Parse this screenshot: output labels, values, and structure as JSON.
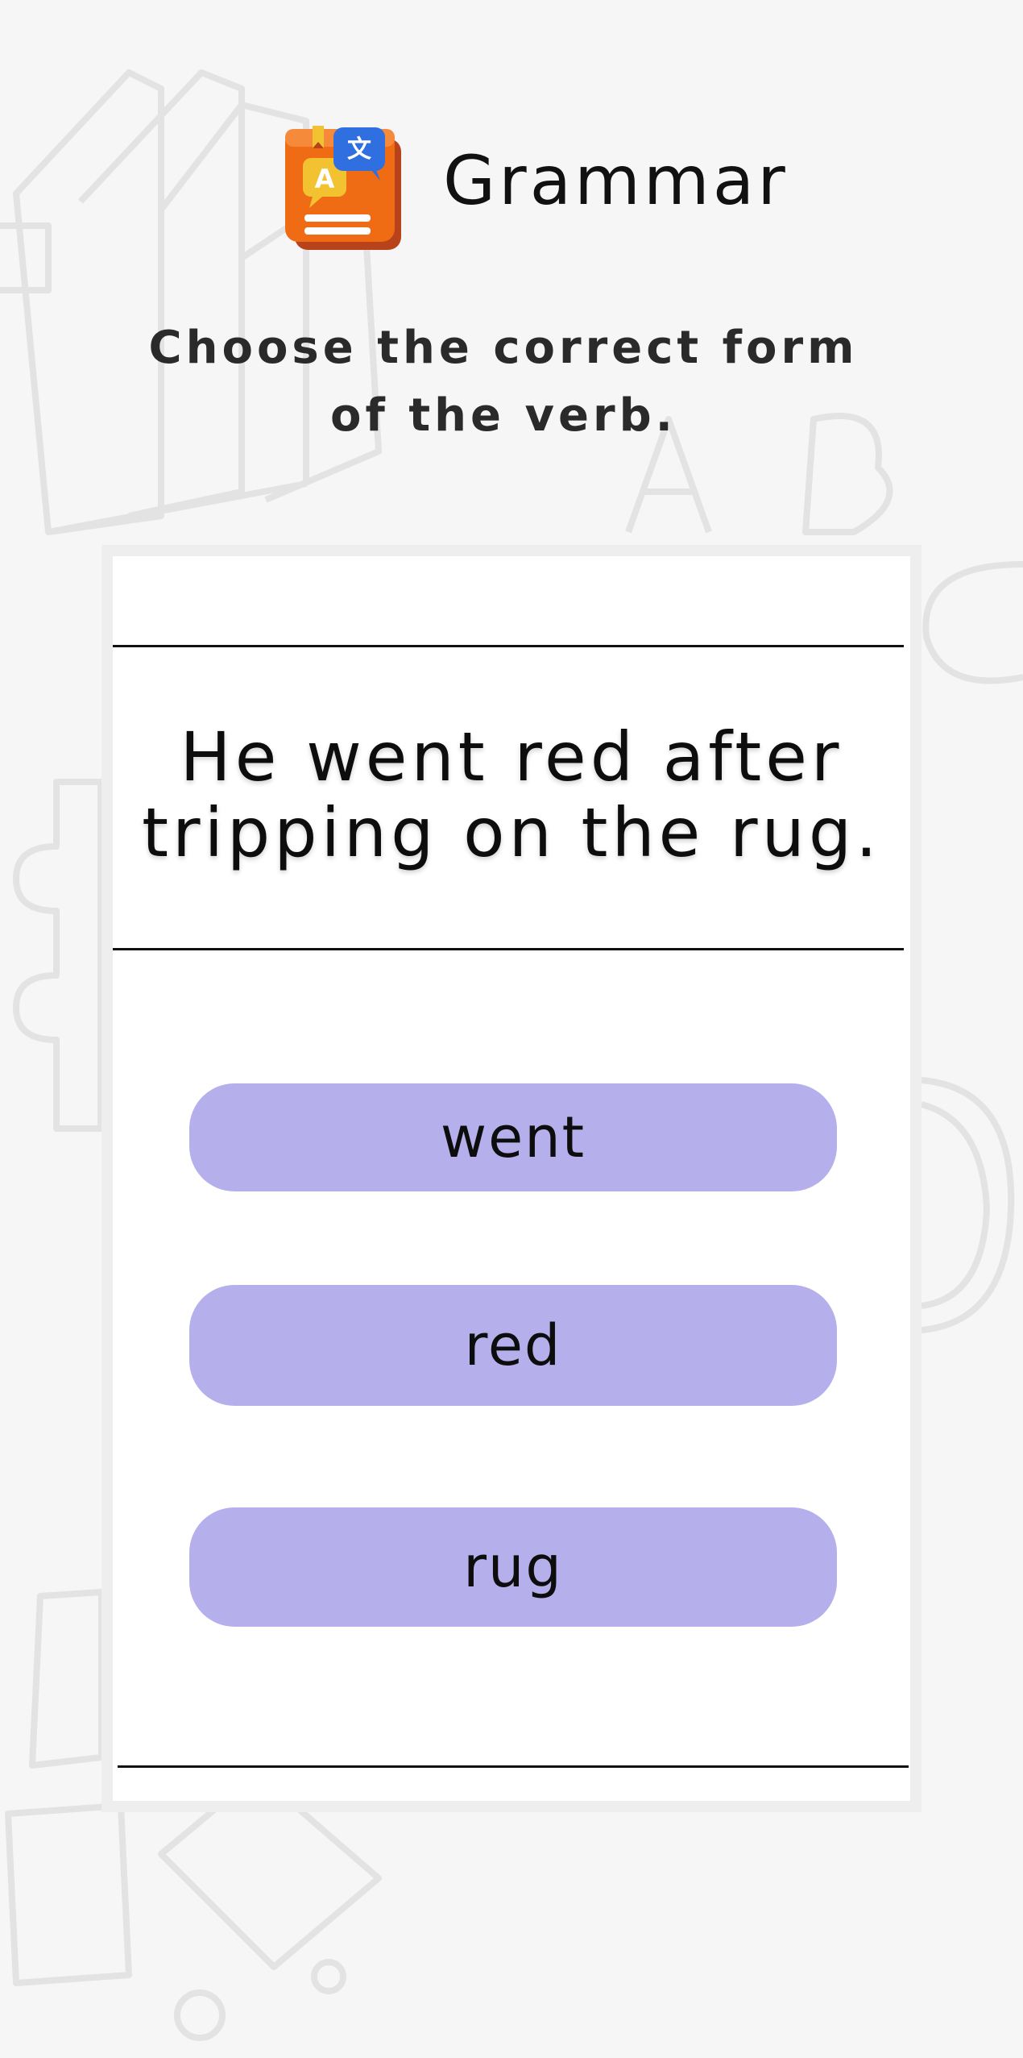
{
  "header": {
    "title": "Grammar",
    "icon": "grammar-book-icon"
  },
  "instruction": "Choose the correct form of the verb.",
  "question": {
    "sentence": "He went red after tripping on the rug."
  },
  "options": [
    {
      "label": "went"
    },
    {
      "label": "red"
    },
    {
      "label": "rug"
    }
  ],
  "colors": {
    "background": "#f6f6f6",
    "card": "#ffffff",
    "option": "#b5afec",
    "icon_book": "#ef6c14",
    "icon_bubble": "#2f6fe0"
  }
}
